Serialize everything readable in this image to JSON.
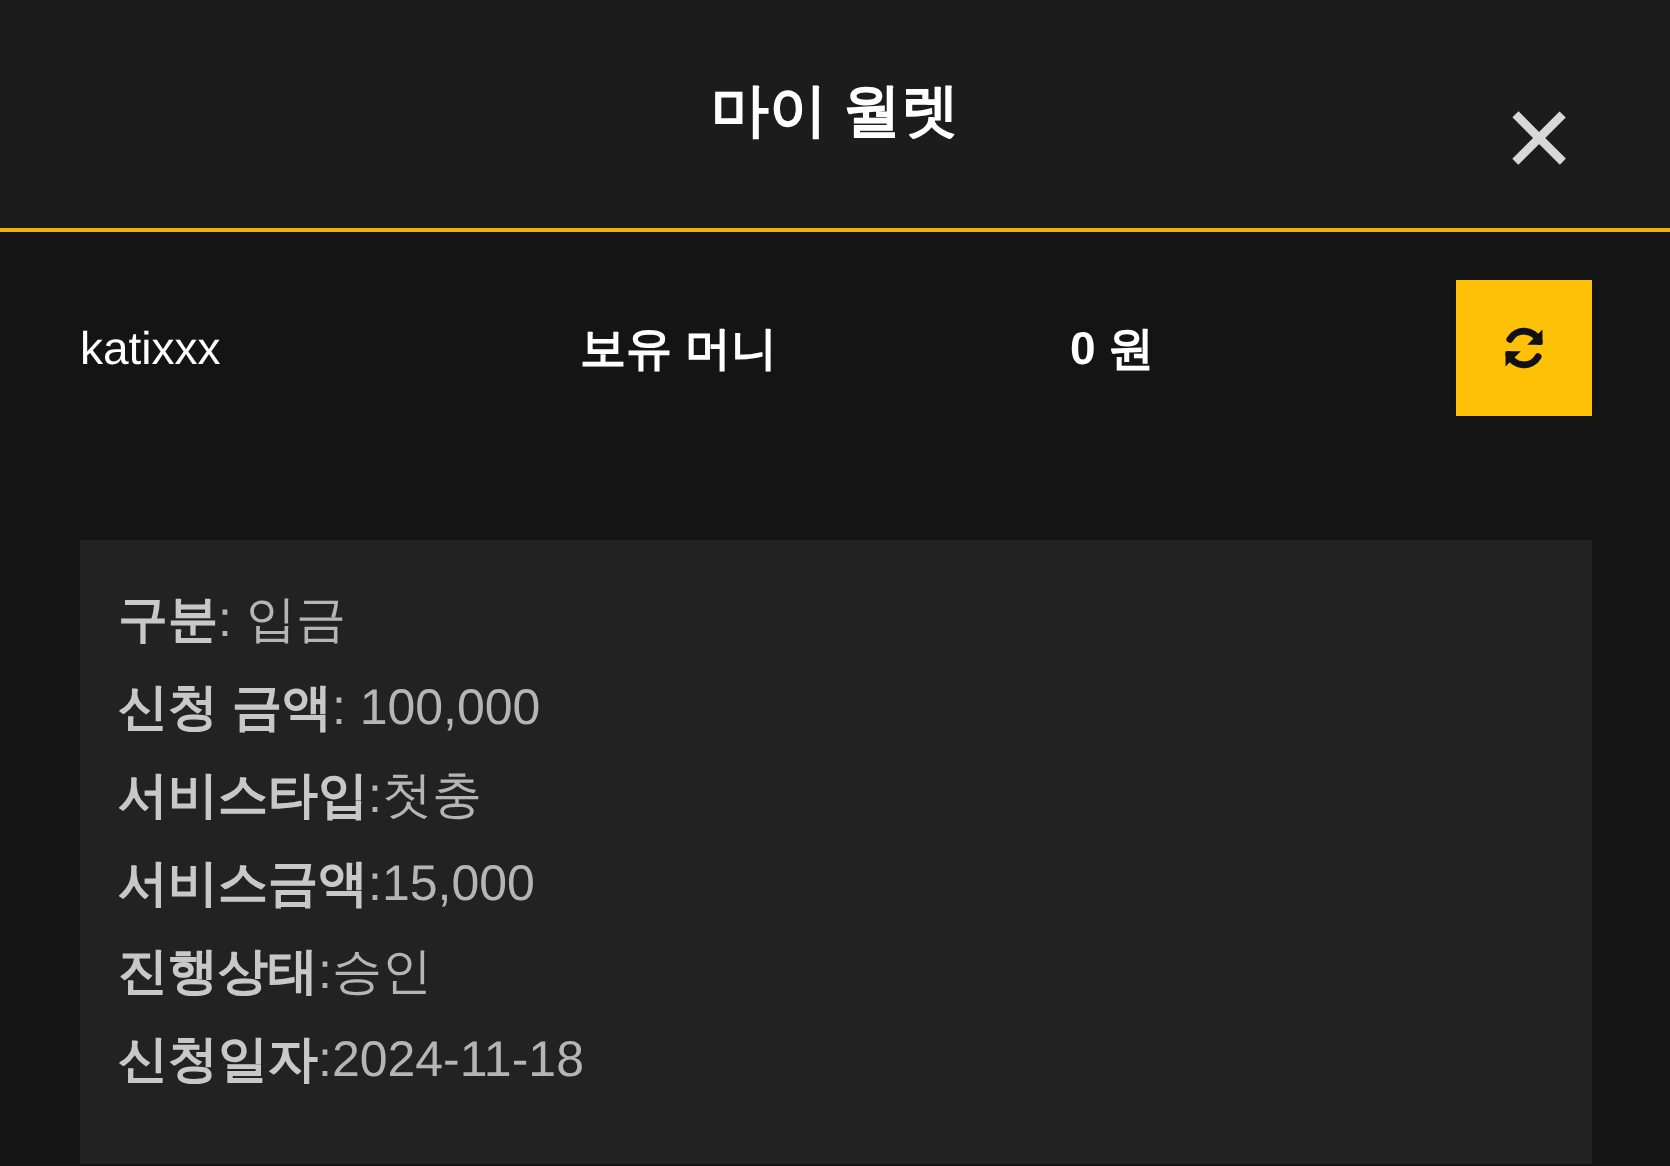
{
  "header": {
    "title": "마이 월렛",
    "close": "×"
  },
  "wallet": {
    "username": "katixxx",
    "balance_label": "보유 머니",
    "balance": "0 원"
  },
  "details": [
    {
      "text": "**구분**: 입금"
    },
    {
      "text": "**신청 금액**: 100,000"
    },
    {
      "text": "**서비스타입**:첫충"
    },
    {
      "text": "**서비스금액**:15,000"
    },
    {
      "text": "**진행상태**:승인"
    },
    {
      "text": "**신청일자**:2024-11-18"
    }
  ]
}
